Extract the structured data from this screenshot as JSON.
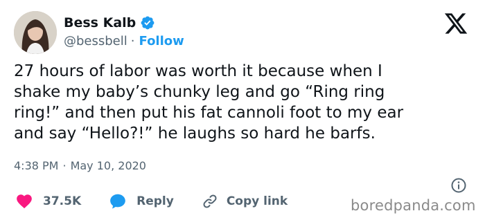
{
  "author": {
    "name": "Bess Kalb",
    "handle": "@bessbell",
    "separator": "·",
    "follow_label": "Follow"
  },
  "tweet": {
    "text": "27 hours of labor was worth it because when I\nshake my baby’s chunky leg and go “Ring ring\nring!” and then put his fat cannoli foot to my ear\nand say “Hello?!” he laughs so hard he barfs.",
    "time": "4:38 PM",
    "separator": "·",
    "date": "May 10, 2020"
  },
  "actions": {
    "like_count": "37.5K",
    "reply_label": "Reply",
    "copy_link_label": "Copy link"
  },
  "watermark": "boredpanda.com",
  "colors": {
    "accent": "#1d9bf0",
    "like": "#f91880",
    "text": "#0f1419",
    "muted": "#536471"
  },
  "icons": {
    "verified": "verified-badge-icon",
    "logo": "x-logo-icon",
    "info": "info-icon",
    "like": "heart-icon",
    "reply": "speech-bubble-icon",
    "copy": "link-icon"
  }
}
